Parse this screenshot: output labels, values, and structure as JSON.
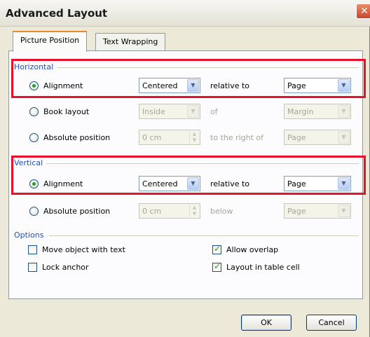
{
  "dialog": {
    "title": "Advanced Layout",
    "close_glyph": "✕"
  },
  "tabs": [
    {
      "label": "Picture Position",
      "active": true
    },
    {
      "label": "Text Wrapping",
      "active": false
    }
  ],
  "horizontal": {
    "group_label": "Horizontal",
    "alignment": {
      "label": "Alignment",
      "value": "Centered",
      "relative_label": "relative to",
      "relative_value": "Page",
      "checked": true
    },
    "book_layout": {
      "label": "Book layout",
      "value": "Inside",
      "of_label": "of",
      "of_value": "Margin",
      "checked": false
    },
    "absolute": {
      "label": "Absolute position",
      "value": "0 cm",
      "rel_label": "to the right of",
      "rel_value": "Page",
      "checked": false
    }
  },
  "vertical": {
    "group_label": "Vertical",
    "alignment": {
      "label": "Alignment",
      "value": "Centered",
      "relative_label": "relative to",
      "relative_value": "Page",
      "checked": true
    },
    "absolute": {
      "label": "Absolute position",
      "value": "0 cm",
      "rel_label": "below",
      "rel_value": "Page",
      "checked": false
    }
  },
  "options": {
    "group_label": "Options",
    "move_with_text": {
      "label": "Move object with text",
      "checked": false
    },
    "lock_anchor": {
      "label": "Lock anchor",
      "checked": false
    },
    "allow_overlap": {
      "label": "Allow overlap",
      "checked": true
    },
    "layout_in_cell": {
      "label": "Layout in table cell",
      "checked": true
    }
  },
  "buttons": {
    "ok": "OK",
    "cancel": "Cancel"
  },
  "colors": {
    "highlight": "#e8102a",
    "group_label": "#1e50c8",
    "check": "#21a121"
  }
}
